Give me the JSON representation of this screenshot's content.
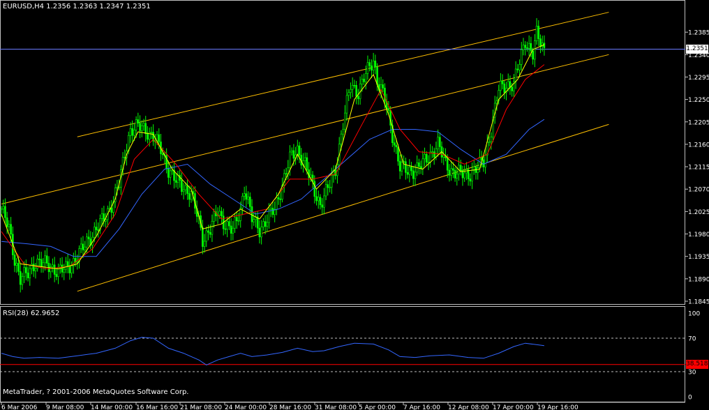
{
  "header": {
    "symbol_timeframe": "EURUSD,H4",
    "ohlc": "1.2356 1.2363 1.2347 1.2351"
  },
  "price_axis": {
    "labels": [
      "1.2385",
      "1.2340",
      "1.2295",
      "1.2250",
      "1.2205",
      "1.2160",
      "1.2115",
      "1.2070",
      "1.2025",
      "1.1980",
      "1.1935",
      "1.1890",
      "1.1845"
    ],
    "current_price": "1.2351"
  },
  "rsi": {
    "label": "RSI(28) 62.9652",
    "levels": [
      "100",
      "70",
      "30",
      "0"
    ],
    "current_marker": "38.5180"
  },
  "time_axis": {
    "labels": [
      "6 Mar 2006",
      "9 Mar 08:00",
      "14 Mar 00:00",
      "16 Mar 16:00",
      "21 Mar 08:00",
      "24 Mar 00:00",
      "28 Mar 16:00",
      "31 Mar 08:00",
      "5 Apr 00:00",
      "7 Apr 16:00",
      "12 Apr 08:00",
      "17 Apr 00:00",
      "19 Apr 16:00"
    ]
  },
  "footer": {
    "copyright": "MetaTrader, ? 2001-2006 MetaQuotes Software Corp."
  },
  "colors": {
    "background": "#000000",
    "candles": "#00ff00",
    "ma_fast": "#ffff00",
    "ma_mid": "#ff0000",
    "ma_slow": "#3366ff",
    "channel": "#ffc000",
    "current_price_line": "#6a7bff",
    "rsi_line": "#3366ff",
    "rsi_level_line": "#ff0000",
    "grid": "#c0c0c0"
  },
  "chart_data": {
    "type": "line",
    "title": "EURUSD,H4",
    "ylim": [
      1.1845,
      1.243
    ],
    "close_path": [
      [
        0,
        1.203
      ],
      [
        4,
        1.199
      ],
      [
        7,
        1.193
      ],
      [
        10,
        1.189
      ],
      [
        14,
        1.19
      ],
      [
        18,
        1.1925
      ],
      [
        22,
        1.192
      ],
      [
        26,
        1.1915
      ],
      [
        30,
        1.1905
      ],
      [
        34,
        1.191
      ],
      [
        38,
        1.1925
      ],
      [
        42,
        1.1945
      ],
      [
        46,
        1.197
      ],
      [
        50,
        1.199
      ],
      [
        54,
        1.201
      ],
      [
        58,
        1.204
      ],
      [
        62,
        1.208
      ],
      [
        66,
        1.216
      ],
      [
        68,
        1.219
      ],
      [
        72,
        1.2195
      ],
      [
        76,
        1.219
      ],
      [
        80,
        1.2175
      ],
      [
        84,
        1.215
      ],
      [
        88,
        1.211
      ],
      [
        92,
        1.2085
      ],
      [
        96,
        1.2075
      ],
      [
        100,
        1.206
      ],
      [
        104,
        1.2005
      ],
      [
        106,
        1.197
      ],
      [
        110,
        1.199
      ],
      [
        114,
        1.2025
      ],
      [
        118,
        1.2
      ],
      [
        122,
        1.1985
      ],
      [
        126,
        1.203
      ],
      [
        128,
        1.2075
      ],
      [
        132,
        1.201
      ],
      [
        136,
        1.199
      ],
      [
        140,
        1.201
      ],
      [
        144,
        1.203
      ],
      [
        148,
        1.208
      ],
      [
        152,
        1.213
      ],
      [
        156,
        1.215
      ],
      [
        160,
        1.212
      ],
      [
        164,
        1.2075
      ],
      [
        168,
        1.204
      ],
      [
        172,
        1.207
      ],
      [
        176,
        1.211
      ],
      [
        180,
        1.22
      ],
      [
        184,
        1.228
      ],
      [
        188,
        1.2265
      ],
      [
        192,
        1.23
      ],
      [
        196,
        1.233
      ],
      [
        198,
        1.229
      ],
      [
        202,
        1.225
      ],
      [
        206,
        1.218
      ],
      [
        210,
        1.2115
      ],
      [
        214,
        1.2105
      ],
      [
        218,
        1.211
      ],
      [
        222,
        1.212
      ],
      [
        226,
        1.214
      ],
      [
        230,
        1.216
      ],
      [
        234,
        1.212
      ],
      [
        238,
        1.2105
      ],
      [
        242,
        1.21
      ],
      [
        246,
        1.21
      ],
      [
        250,
        1.211
      ],
      [
        254,
        1.2125
      ],
      [
        258,
        1.219
      ],
      [
        262,
        1.227
      ],
      [
        266,
        1.228
      ],
      [
        270,
        1.228
      ],
      [
        274,
        1.234
      ],
      [
        276,
        1.237
      ],
      [
        280,
        1.234
      ],
      [
        282,
        1.238
      ],
      [
        286,
        1.2351
      ]
    ],
    "ma_fast": [
      [
        0,
        1.202
      ],
      [
        10,
        1.192
      ],
      [
        20,
        1.1915
      ],
      [
        30,
        1.191
      ],
      [
        40,
        1.192
      ],
      [
        50,
        1.1975
      ],
      [
        60,
        1.205
      ],
      [
        66,
        1.214
      ],
      [
        72,
        1.2185
      ],
      [
        80,
        1.218
      ],
      [
        90,
        1.211
      ],
      [
        100,
        1.207
      ],
      [
        106,
        1.199
      ],
      [
        116,
        1.2
      ],
      [
        126,
        1.203
      ],
      [
        136,
        1.201
      ],
      [
        146,
        1.206
      ],
      [
        156,
        1.214
      ],
      [
        166,
        1.207
      ],
      [
        176,
        1.211
      ],
      [
        186,
        1.225
      ],
      [
        196,
        1.23
      ],
      [
        204,
        1.222
      ],
      [
        212,
        1.212
      ],
      [
        222,
        1.211
      ],
      [
        232,
        1.2145
      ],
      [
        242,
        1.2105
      ],
      [
        252,
        1.211
      ],
      [
        262,
        1.225
      ],
      [
        272,
        1.229
      ],
      [
        280,
        1.235
      ],
      [
        286,
        1.236
      ]
    ],
    "ma_mid": [
      [
        0,
        1.1985
      ],
      [
        12,
        1.192
      ],
      [
        24,
        1.191
      ],
      [
        36,
        1.1915
      ],
      [
        48,
        1.195
      ],
      [
        60,
        1.202
      ],
      [
        70,
        1.213
      ],
      [
        80,
        1.217
      ],
      [
        92,
        1.212
      ],
      [
        104,
        1.206
      ],
      [
        116,
        1.201
      ],
      [
        128,
        1.202
      ],
      [
        140,
        1.203
      ],
      [
        152,
        1.209
      ],
      [
        164,
        1.209
      ],
      [
        176,
        1.21
      ],
      [
        190,
        1.22
      ],
      [
        200,
        1.227
      ],
      [
        210,
        1.219
      ],
      [
        220,
        1.2145
      ],
      [
        232,
        1.214
      ],
      [
        244,
        1.212
      ],
      [
        256,
        1.214
      ],
      [
        266,
        1.223
      ],
      [
        276,
        1.229
      ],
      [
        286,
        1.232
      ]
    ],
    "ma_slow": [
      [
        0,
        1.1965
      ],
      [
        14,
        1.196
      ],
      [
        26,
        1.1955
      ],
      [
        38,
        1.1935
      ],
      [
        50,
        1.1935
      ],
      [
        62,
        1.199
      ],
      [
        74,
        1.206
      ],
      [
        86,
        1.211
      ],
      [
        98,
        1.212
      ],
      [
        110,
        1.208
      ],
      [
        122,
        1.205
      ],
      [
        134,
        1.202
      ],
      [
        146,
        1.203
      ],
      [
        158,
        1.205
      ],
      [
        170,
        1.209
      ],
      [
        182,
        1.213
      ],
      [
        194,
        1.217
      ],
      [
        206,
        1.219
      ],
      [
        218,
        1.219
      ],
      [
        230,
        1.2185
      ],
      [
        242,
        1.215
      ],
      [
        254,
        1.212
      ],
      [
        266,
        1.214
      ],
      [
        278,
        1.219
      ],
      [
        286,
        1.221
      ]
    ],
    "channel_lines": [
      {
        "from": [
          40,
          1.2175
        ],
        "to": [
          320,
          1.2425
        ]
      },
      {
        "from": [
          0,
          1.204
        ],
        "to": [
          320,
          1.234
        ]
      },
      {
        "from": [
          40,
          1.1865
        ],
        "to": [
          320,
          1.22
        ]
      }
    ],
    "rsi_series": [
      [
        0,
        52
      ],
      [
        6,
        48
      ],
      [
        12,
        46
      ],
      [
        20,
        47
      ],
      [
        30,
        46
      ],
      [
        40,
        49
      ],
      [
        50,
        52
      ],
      [
        60,
        58
      ],
      [
        68,
        67
      ],
      [
        74,
        71
      ],
      [
        80,
        70
      ],
      [
        88,
        58
      ],
      [
        96,
        52
      ],
      [
        104,
        44
      ],
      [
        108,
        38
      ],
      [
        114,
        44
      ],
      [
        120,
        48
      ],
      [
        126,
        52
      ],
      [
        132,
        48
      ],
      [
        140,
        50
      ],
      [
        148,
        53
      ],
      [
        156,
        58
      ],
      [
        164,
        54
      ],
      [
        170,
        55
      ],
      [
        178,
        60
      ],
      [
        186,
        64
      ],
      [
        196,
        63
      ],
      [
        204,
        56
      ],
      [
        210,
        48
      ],
      [
        218,
        47
      ],
      [
        226,
        49
      ],
      [
        236,
        50
      ],
      [
        246,
        47
      ],
      [
        254,
        46
      ],
      [
        262,
        52
      ],
      [
        270,
        60
      ],
      [
        276,
        64
      ],
      [
        286,
        61
      ]
    ],
    "rsi_levels": [
      70,
      38.518,
      30
    ]
  }
}
